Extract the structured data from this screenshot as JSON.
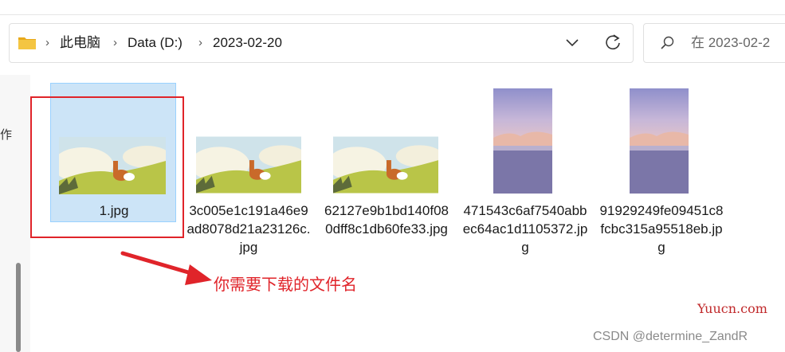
{
  "breadcrumb": {
    "items": [
      "此电脑",
      "Data (D:)",
      "2023-02-20"
    ],
    "separator": "›"
  },
  "search": {
    "placeholder": "在 2023-02-2"
  },
  "left_pane": {
    "glyph": "作"
  },
  "files": [
    {
      "name": "1.jpg",
      "thumb": "fox",
      "selected": true
    },
    {
      "name": "3c005e1c191a46e9ad8078d21a23126c.jpg",
      "thumb": "fox",
      "selected": false
    },
    {
      "name": "62127e9b1bd140f080dff8c1db60fe33.jpg",
      "thumb": "fox",
      "selected": false
    },
    {
      "name": "471543c6af7540abbec64ac1d1105372.jpg",
      "thumb": "sea",
      "selected": false
    },
    {
      "name": "91929249fe09451c8fcbc315a95518eb.jpg",
      "thumb": "sea",
      "selected": false
    }
  ],
  "annotation": {
    "text": "你需要下载的文件名",
    "color": "#e0242a"
  },
  "watermarks": {
    "site": "Yuucn.com",
    "author": "CSDN @determine_ZandR"
  },
  "colors": {
    "selection_bg": "#cce4f7",
    "selection_border": "#99d1ff",
    "folder": "#f4c542"
  }
}
